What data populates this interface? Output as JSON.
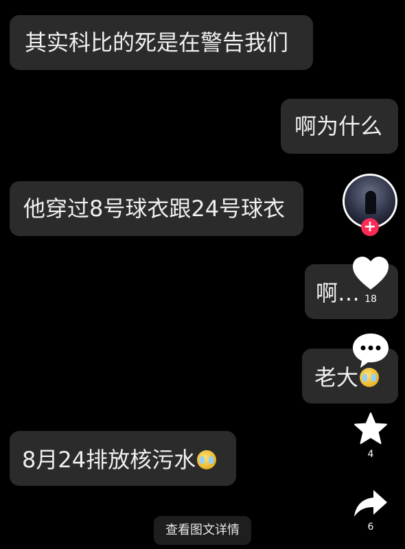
{
  "messages": [
    {
      "text": "其实科比的死是在警告我们",
      "side": "left"
    },
    {
      "text": "啊为什么",
      "side": "right"
    },
    {
      "text": "他穿过8号球衣跟24号球衣",
      "side": "left"
    },
    {
      "text": "啊…",
      "side": "right"
    },
    {
      "text": "老大",
      "side": "right",
      "emoji": "crying-face"
    },
    {
      "text": "8月24排放核污水",
      "side": "left",
      "emoji": "crying-face"
    }
  ],
  "actions": {
    "follow_symbol": "+",
    "like_count": "18",
    "favorite_count": "4",
    "share_count": "6"
  },
  "footer": {
    "details_label": "查看图文详情"
  },
  "colors": {
    "background": "#000000",
    "bubble": "#2b2b2b",
    "follow_badge": "#fe2c55"
  }
}
